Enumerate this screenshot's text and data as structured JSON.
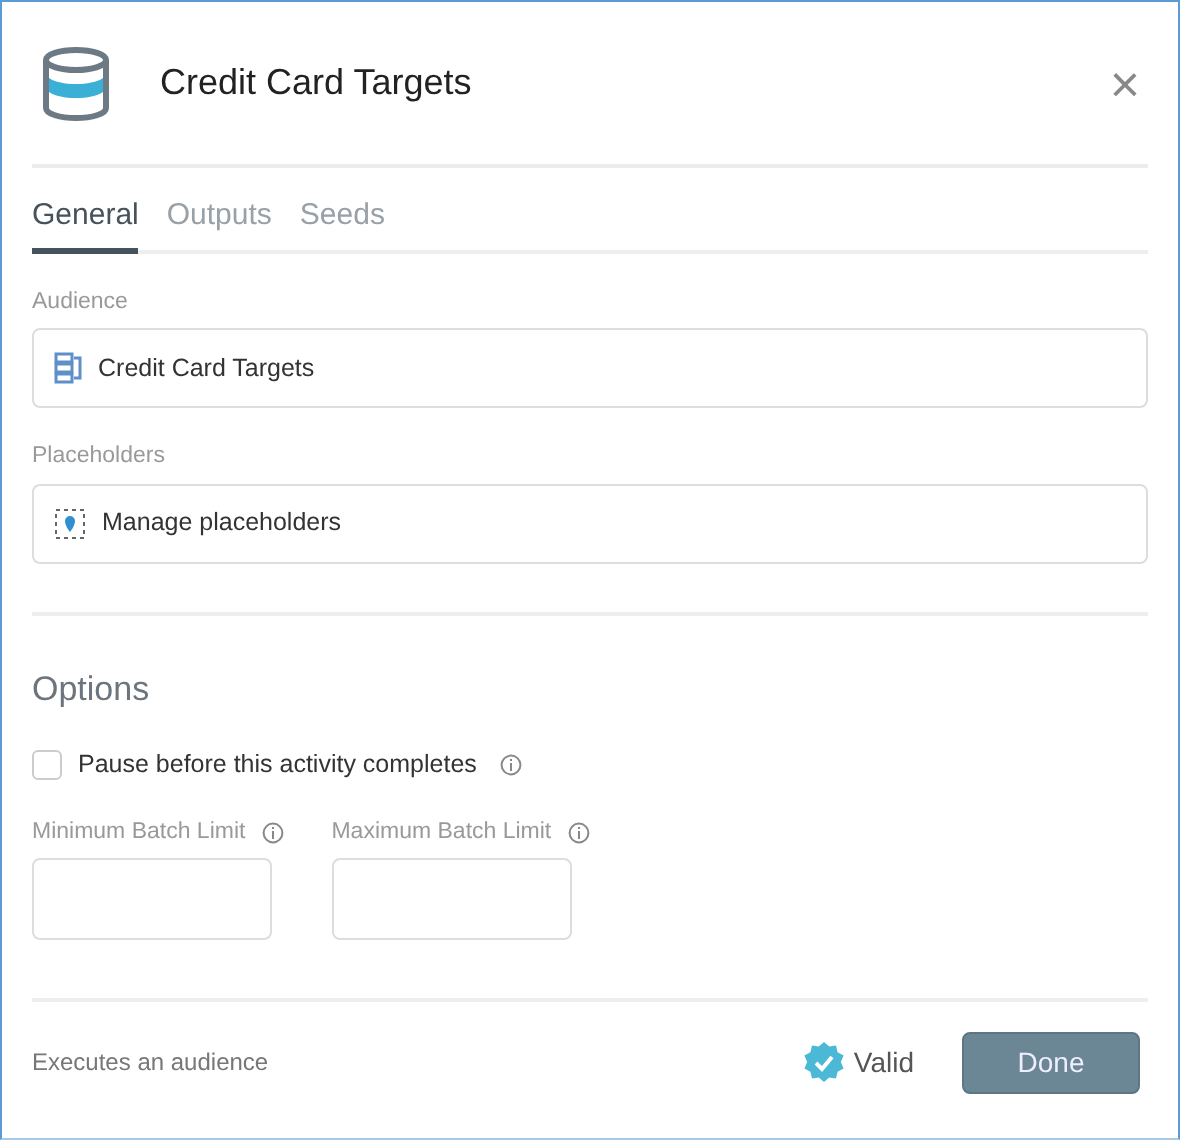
{
  "dialog": {
    "title": "Credit Card Targets",
    "close": "×"
  },
  "tabs": [
    {
      "label": "General",
      "selected": true
    },
    {
      "label": "Outputs",
      "selected": false
    },
    {
      "label": "Seeds",
      "selected": false
    }
  ],
  "audience": {
    "label": "Audience",
    "value": "Credit Card Targets"
  },
  "placeholders": {
    "label": "Placeholders",
    "value": "Manage placeholders"
  },
  "options": {
    "heading": "Options",
    "pause": {
      "label": "Pause before this activity completes",
      "checked": false
    },
    "limits": [
      {
        "label": "Minimum Batch Limit"
      },
      {
        "label": "Maximum Batch Limit"
      }
    ]
  },
  "footer": {
    "description": "Executes an audience",
    "status": "Valid",
    "button": "Done"
  }
}
